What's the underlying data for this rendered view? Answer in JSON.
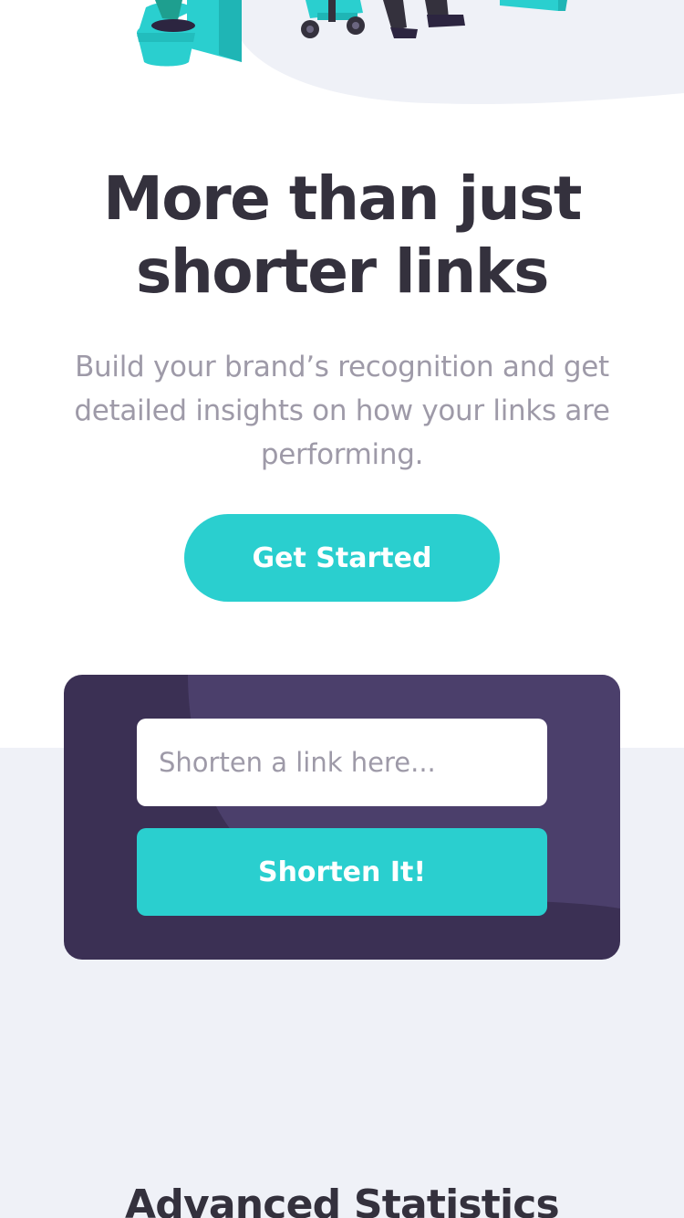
{
  "hero": {
    "title": "More than just shorter links",
    "subtitle": "Build your brand’s recognition and get detailed insights on how your links are performing.",
    "cta_label": "Get Started"
  },
  "shorten": {
    "placeholder": "Shorten a link here...",
    "button_label": "Shorten It!"
  },
  "stats": {
    "heading": "Advanced Statistics"
  },
  "colors": {
    "primary": "#2acfcf",
    "dark_violet": "#3b3054",
    "heading_text": "#34313d",
    "muted_text": "#9e9aa8",
    "gray_background": "#eff1f7"
  }
}
